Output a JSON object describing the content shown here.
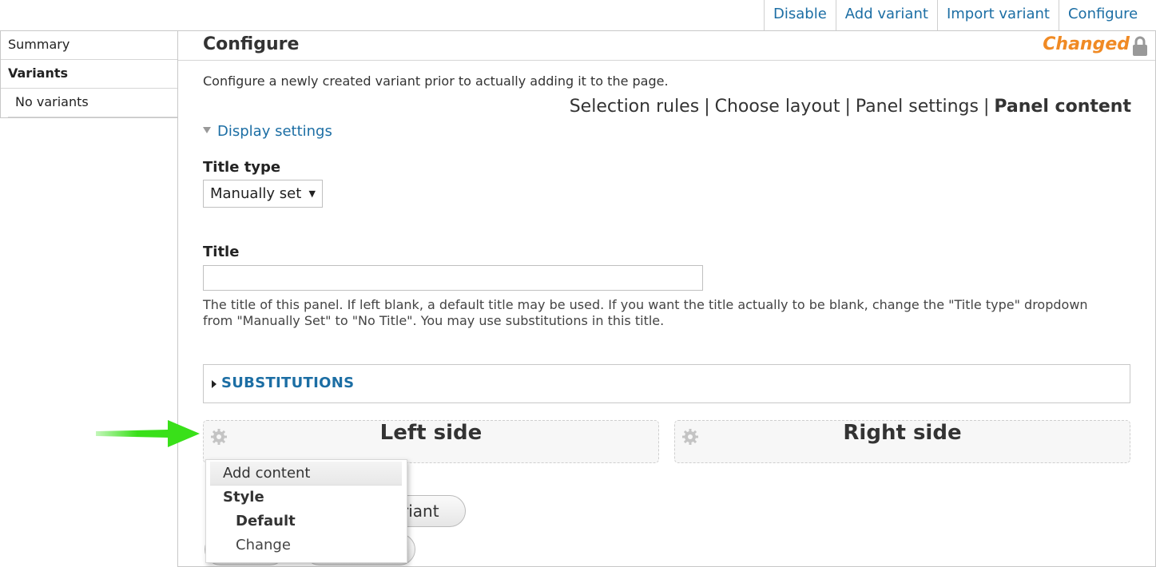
{
  "top_tabs": [
    "Disable",
    "Add variant",
    "Import variant",
    "Configure"
  ],
  "sidebar": {
    "summary": "Summary",
    "variants": "Variants",
    "no_variants": "No variants"
  },
  "main": {
    "title": "Configure",
    "status": "Changed",
    "intro": "Configure a newly created variant prior to actually adding it to the page.",
    "steps": {
      "selection_rules": "Selection rules",
      "choose_layout": "Choose layout",
      "panel_settings": "Panel settings",
      "panel_content": "Panel content",
      "separator": "|"
    },
    "display_settings": "Display settings",
    "title_type_label": "Title type",
    "title_type_value": "Manually set",
    "title_label": "Title",
    "title_value": "",
    "title_help": "The title of this panel. If left blank, a default title may be used. If you want the title actually to be blank, change the \"Title type\" dropdown from \"Manually Set\" to \"No Title\". You may use substitutions in this title.",
    "substitutions": "SUBSTITUTIONS",
    "left_region": "Left side",
    "right_region": "Right side",
    "partial_button": "riant"
  },
  "dropdown": {
    "add_content": "Add content",
    "style": "Style",
    "default": "Default",
    "change": "Change"
  },
  "colors": {
    "link": "#1c6ea4",
    "changed": "#f08a24",
    "arrow": "#39e019"
  },
  "icons": [
    "lock-icon",
    "gear-icon",
    "triangle-down-icon",
    "triangle-right-icon",
    "arrow-icon"
  ]
}
